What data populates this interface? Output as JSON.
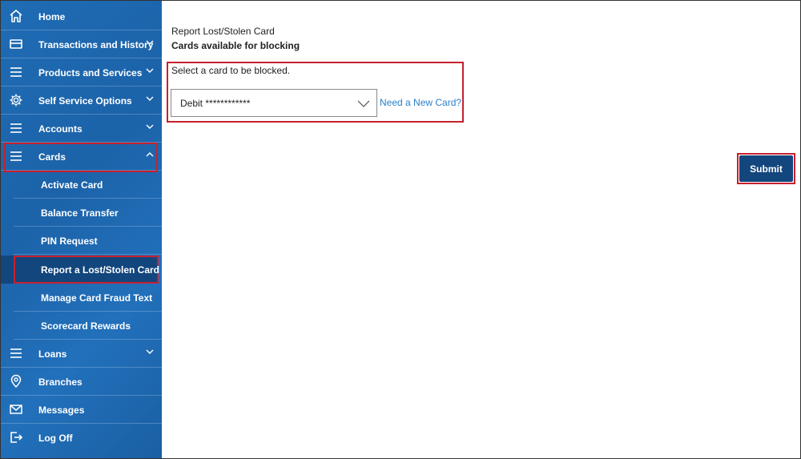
{
  "sidebar": {
    "items": [
      {
        "label": "Home",
        "icon": "home-icon"
      },
      {
        "label": "Transactions and History",
        "icon": "card-icon"
      },
      {
        "label": "Products and Services",
        "icon": "menu-icon"
      },
      {
        "label": "Self Service Options",
        "icon": "gear-icon"
      },
      {
        "label": "Accounts",
        "icon": "menu-icon"
      },
      {
        "label": "Cards",
        "icon": "menu-icon",
        "expanded": true
      },
      {
        "label": "Loans",
        "icon": "menu-icon"
      },
      {
        "label": "Branches",
        "icon": "location-pin-icon"
      },
      {
        "label": "Messages",
        "icon": "envelope-icon"
      },
      {
        "label": "Log Off",
        "icon": "logout-icon"
      }
    ],
    "card_sub_items": [
      {
        "label": "Activate Card"
      },
      {
        "label": "Balance Transfer"
      },
      {
        "label": "PIN Request"
      },
      {
        "label": "Report a Lost/Stolen Card",
        "active": true
      },
      {
        "label": "Manage Card Fraud Text"
      },
      {
        "label": "Scorecard Rewards"
      }
    ]
  },
  "main": {
    "title": "Report Lost/Stolen Card",
    "subtitle": "Cards available for blocking",
    "select_label": "Select a card to be blocked.",
    "selected_card": "Debit ************",
    "new_card_link": "Need a New Card?",
    "submit_label": "Submit"
  },
  "colors": {
    "sidebar_blue": "#1f6cb5",
    "active_navy": "#13467d",
    "highlight_red": "#c8202e",
    "link_blue": "#2a7fc9"
  }
}
